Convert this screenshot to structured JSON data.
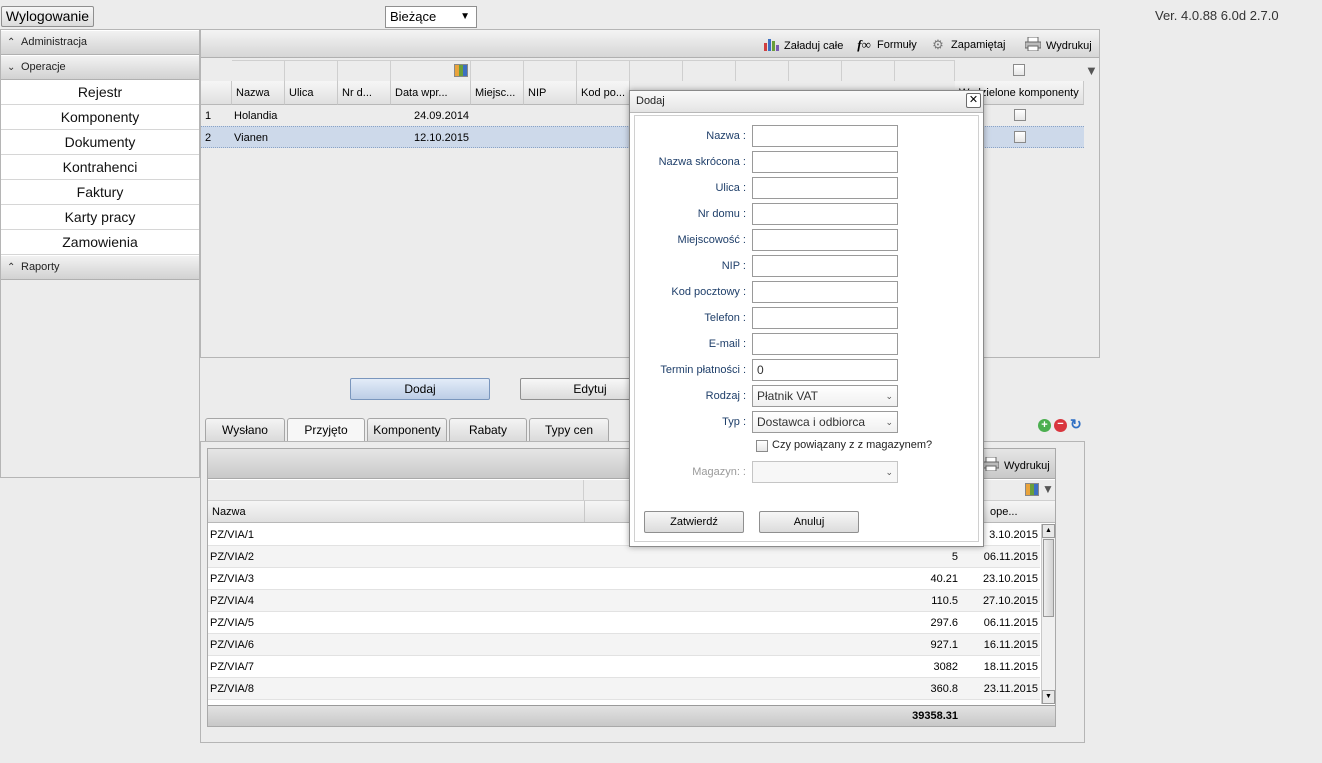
{
  "topbar": {
    "logout_label": "Wylogowanie",
    "period_select": "Bieżące",
    "version": "Ver. 4.0.88 6.0d 2.7.0"
  },
  "sidebar": {
    "sections": [
      {
        "label": "Administracja",
        "chevron": "up"
      },
      {
        "label": "Operacje",
        "chevron": "down"
      },
      {
        "label": "Raporty",
        "chevron": "up"
      }
    ],
    "items": [
      "Rejestr",
      "Komponenty",
      "Dokumenty",
      "Kontrahenci",
      "Faktury",
      "Karty pracy",
      "Zamowienia"
    ]
  },
  "toolbar": {
    "load_all": "Załaduj całe",
    "formulas": "Formuły",
    "remember": "Zapamiętaj",
    "print": "Wydrukuj"
  },
  "top_grid": {
    "columns": [
      "Nazwa",
      "Ulica",
      "Nr d...",
      "Data wpr...",
      "Miejsc...",
      "NIP",
      "Kod po..."
    ],
    "right_column": "Wydzielone komponenty",
    "rows": [
      {
        "num": "1",
        "name": "Holandia",
        "date": "24.09.2014"
      },
      {
        "num": "2",
        "name": "Vianen",
        "date": "12.10.2015"
      }
    ]
  },
  "actions": {
    "add": "Dodaj",
    "edit": "Edytuj"
  },
  "tabs": [
    "Wysłano",
    "Przyjęto",
    "Komponenty",
    "Rabaty",
    "Typy cen"
  ],
  "active_tab": "Przyjęto",
  "bottom_grid": {
    "print": "Wydrukuj",
    "col_name": "Nazwa",
    "col_date": "ope...",
    "rows": [
      {
        "name": "PZ/VIA/1",
        "value": "",
        "date": "3.10.2015"
      },
      {
        "name": "PZ/VIA/2",
        "value": "5",
        "date": "06.11.2015"
      },
      {
        "name": "PZ/VIA/3",
        "value": "40.21",
        "date": "23.10.2015"
      },
      {
        "name": "PZ/VIA/4",
        "value": "110.5",
        "date": "27.10.2015"
      },
      {
        "name": "PZ/VIA/5",
        "value": "297.6",
        "date": "06.11.2015"
      },
      {
        "name": "PZ/VIA/6",
        "value": "927.1",
        "date": "16.11.2015"
      },
      {
        "name": "PZ/VIA/7",
        "value": "3082",
        "date": "18.11.2015"
      },
      {
        "name": "PZ/VIA/8",
        "value": "360.8",
        "date": "23.11.2015"
      }
    ],
    "total": "39358.31"
  },
  "dialog": {
    "title": "Dodaj",
    "fields": [
      {
        "label": "Nazwa :",
        "value": ""
      },
      {
        "label": "Nazwa skrócona :",
        "value": ""
      },
      {
        "label": "Ulica :",
        "value": ""
      },
      {
        "label": "Nr domu :",
        "value": ""
      },
      {
        "label": "Miejscowość :",
        "value": ""
      },
      {
        "label": "NIP :",
        "value": ""
      },
      {
        "label": "Kod pocztowy :",
        "value": ""
      },
      {
        "label": "Telefon :",
        "value": ""
      },
      {
        "label": "E-mail :",
        "value": ""
      },
      {
        "label": "Termin płatności :",
        "value": "0"
      }
    ],
    "rodzaj_label": "Rodzaj :",
    "rodzaj_value": "Płatnik VAT",
    "typ_label": "Typ :",
    "typ_value": "Dostawca i odbiorca",
    "linked_checkbox": "Czy powiązany z z magazynem?",
    "magazyn_label": "Magazyn: :",
    "magazyn_value": "",
    "confirm": "Zatwierdź",
    "cancel": "Anuluj"
  }
}
